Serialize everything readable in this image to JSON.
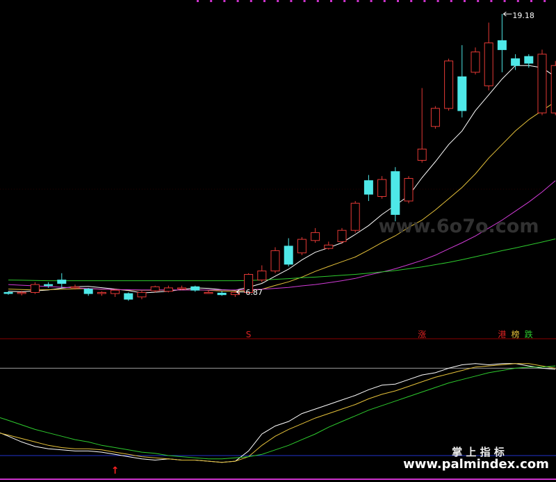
{
  "chart_data": [
    {
      "type": "candlestick",
      "panel": "price",
      "title": "",
      "xlabel": "",
      "ylabel": "",
      "ylim": [
        4.8,
        19.8
      ],
      "grid": false,
      "candles": [
        [
          6.85,
          6.8,
          6.9,
          6.75
        ],
        [
          6.8,
          6.85,
          6.92,
          6.72
        ],
        [
          6.85,
          7.2,
          7.3,
          6.78
        ],
        [
          7.2,
          7.15,
          7.3,
          7.05
        ],
        [
          7.4,
          7.25,
          7.7,
          7.05
        ],
        [
          7.05,
          7.1,
          7.2,
          6.98
        ],
        [
          7.0,
          6.8,
          7.05,
          6.7
        ],
        [
          6.8,
          6.85,
          6.9,
          6.7
        ],
        [
          6.8,
          6.95,
          7.0,
          6.65
        ],
        [
          6.8,
          6.55,
          6.85,
          6.48
        ],
        [
          6.65,
          6.85,
          6.92,
          6.55
        ],
        [
          6.92,
          7.1,
          7.15,
          6.85
        ],
        [
          6.9,
          7.05,
          7.15,
          6.85
        ],
        [
          7.0,
          7.05,
          7.15,
          6.95
        ],
        [
          7.1,
          6.95,
          7.15,
          6.88
        ],
        [
          6.82,
          6.85,
          6.95,
          6.8
        ],
        [
          6.82,
          6.75,
          6.9,
          6.7
        ],
        [
          6.75,
          6.85,
          6.9,
          6.65
        ],
        [
          6.85,
          7.65,
          7.7,
          6.8
        ],
        [
          7.4,
          7.8,
          8.05,
          7.3
        ],
        [
          7.8,
          8.7,
          8.85,
          7.7
        ],
        [
          8.9,
          8.1,
          9.25,
          8.0
        ],
        [
          8.6,
          9.2,
          9.3,
          8.5
        ],
        [
          9.15,
          9.5,
          9.7,
          9.05
        ],
        [
          8.8,
          8.95,
          9.1,
          8.75
        ],
        [
          9.1,
          9.6,
          9.7,
          9.0
        ],
        [
          9.6,
          10.8,
          10.9,
          9.5
        ],
        [
          11.8,
          11.2,
          12.05,
          10.9
        ],
        [
          11.1,
          11.85,
          12.0,
          11.0
        ],
        [
          12.2,
          10.3,
          12.4,
          10.0
        ],
        [
          10.9,
          11.9,
          12.0,
          10.8
        ],
        [
          12.7,
          13.2,
          15.9,
          12.6
        ],
        [
          14.2,
          15.0,
          15.1,
          14.1
        ],
        [
          15.0,
          17.1,
          17.2,
          14.9
        ],
        [
          16.4,
          14.9,
          17.8,
          14.6
        ],
        [
          16.6,
          17.5,
          17.7,
          16.5
        ],
        [
          16.0,
          17.9,
          18.8,
          15.8
        ],
        [
          18.0,
          17.6,
          19.18,
          16.6
        ],
        [
          17.2,
          16.9,
          17.4,
          16.7
        ],
        [
          17.3,
          17.0,
          17.4,
          16.8
        ],
        [
          14.8,
          17.4,
          17.6,
          14.7
        ],
        [
          14.8,
          16.9,
          17.1,
          14.7
        ]
      ],
      "series": [
        {
          "kind": "ma",
          "color": "#ffffff",
          "values": [
            6.9,
            6.88,
            6.92,
            6.96,
            7.04,
            7.1,
            7.12,
            7.06,
            7.0,
            6.93,
            6.83,
            6.86,
            6.9,
            6.98,
            7.05,
            7.03,
            6.97,
            6.95,
            7.08,
            7.25,
            7.57,
            7.88,
            8.29,
            8.63,
            8.83,
            9.05,
            9.42,
            9.81,
            10.3,
            10.71,
            11.13,
            11.93,
            12.64,
            13.4,
            14.0,
            14.9,
            15.6,
            16.3,
            16.9,
            16.9,
            16.8,
            16.4
          ]
        },
        {
          "kind": "ma",
          "color": "#e6c23a",
          "values": [
            7.0,
            6.98,
            6.96,
            6.97,
            6.99,
            7.01,
            7.02,
            6.99,
            6.98,
            6.96,
            6.95,
            6.95,
            6.95,
            6.96,
            6.97,
            6.95,
            6.91,
            6.91,
            6.93,
            6.99,
            7.16,
            7.32,
            7.53,
            7.78,
            8.0,
            8.21,
            8.42,
            8.73,
            9.06,
            9.36,
            9.73,
            10.05,
            10.5,
            11.0,
            11.5,
            12.1,
            12.8,
            13.4,
            14.0,
            14.5,
            14.9,
            15.3
          ]
        },
        {
          "kind": "ma",
          "color": "#d23cd8",
          "values": [
            7.2,
            7.17,
            7.14,
            7.11,
            7.08,
            7.05,
            7.02,
            7.0,
            6.98,
            6.97,
            6.96,
            6.96,
            6.96,
            6.96,
            6.96,
            6.96,
            6.96,
            6.96,
            6.97,
            6.99,
            7.03,
            7.07,
            7.14,
            7.2,
            7.28,
            7.37,
            7.47,
            7.62,
            7.75,
            7.9,
            8.08,
            8.27,
            8.5,
            8.78,
            9.05,
            9.35,
            9.7,
            10.05,
            10.45,
            10.85,
            11.3,
            11.8
          ]
        },
        {
          "kind": "ma",
          "color": "#2ecc2e",
          "values": [
            7.4,
            7.39,
            7.38,
            7.37,
            7.37,
            7.37,
            7.37,
            7.37,
            7.37,
            7.37,
            7.37,
            7.37,
            7.37,
            7.37,
            7.37,
            7.37,
            7.37,
            7.37,
            7.38,
            7.4,
            7.43,
            7.46,
            7.5,
            7.53,
            7.57,
            7.61,
            7.65,
            7.7,
            7.76,
            7.82,
            7.9,
            7.98,
            8.08,
            8.18,
            8.3,
            8.43,
            8.56,
            8.7,
            8.82,
            8.95,
            9.08,
            9.22
          ]
        }
      ],
      "annotations": [
        {
          "text": "19.18",
          "index": 37,
          "value": 19.18,
          "kind": "high"
        },
        {
          "text": "6.87",
          "index": 17,
          "value": 6.87,
          "kind": "low"
        }
      ]
    },
    {
      "type": "line",
      "panel": "indicator",
      "title": "",
      "xlabel": "",
      "ylabel": "",
      "ylim": [
        -3,
        100
      ],
      "grid": false,
      "reference_lines": [
        {
          "value": 82,
          "color": "#9e9e9e"
        },
        {
          "value": 5,
          "color": "#2233cc"
        }
      ],
      "series": [
        {
          "color": "#ffffff",
          "values": [
            22,
            17,
            13,
            11,
            10,
            9,
            9,
            8,
            6,
            4,
            2,
            1,
            2,
            1,
            1,
            0,
            -1,
            0,
            9,
            24,
            31,
            35,
            42,
            46,
            50,
            54,
            58,
            63,
            67,
            68,
            72,
            76,
            78,
            82,
            85,
            86,
            85,
            86,
            86,
            84,
            82,
            81
          ]
        },
        {
          "color": "#e6c23a",
          "values": [
            23,
            20,
            17,
            14,
            12,
            11,
            11,
            10,
            8,
            6,
            4,
            3,
            2,
            1,
            1,
            0,
            -1,
            0,
            4,
            14,
            22,
            28,
            33,
            38,
            42,
            46,
            50,
            55,
            59,
            62,
            66,
            70,
            74,
            77,
            80,
            83,
            84,
            85,
            86,
            86,
            84,
            82
          ]
        },
        {
          "color": "#2ecc2e",
          "values": [
            36,
            32,
            28,
            25,
            22,
            19,
            17,
            14,
            12,
            10,
            8,
            7,
            5,
            4,
            3,
            2,
            2,
            3,
            4,
            6,
            10,
            14,
            19,
            24,
            30,
            35,
            40,
            45,
            49,
            53,
            57,
            61,
            65,
            69,
            72,
            75,
            78,
            80,
            82,
            83,
            83,
            84
          ]
        }
      ],
      "markers": [
        {
          "text": "S",
          "index": 18,
          "color": "#dd2222"
        },
        {
          "text": "涨",
          "index": 31,
          "color": "#dd2222"
        },
        {
          "text": "港",
          "index": 37,
          "color": "#dd2222"
        },
        {
          "text": "榜",
          "index": 38,
          "color": "#e6c23a"
        },
        {
          "text": "跌",
          "index": 39,
          "color": "#2ecc2e"
        },
        {
          "text": "↑",
          "index": 8,
          "color": "#ff2222"
        }
      ]
    }
  ],
  "watermarks": {
    "mid": "www.6o7o.com",
    "brand": "掌 上 指 标",
    "url": "www.palmindex.com"
  },
  "colors": {
    "background": "#000000",
    "up": "#e53935",
    "down": "#4ee8e8",
    "separator": "#8b0000",
    "top_markers": "#cc33cc"
  }
}
